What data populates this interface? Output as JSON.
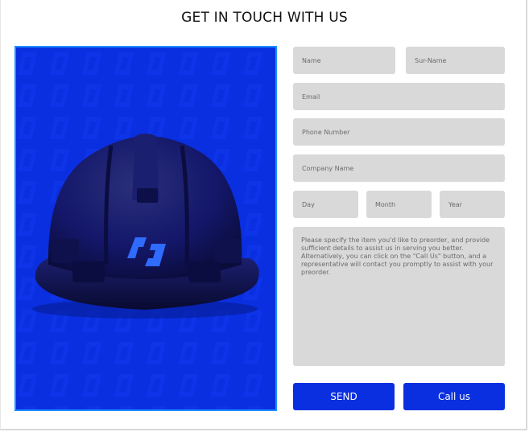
{
  "page": {
    "title": "GET IN TOUCH WITH US"
  },
  "form": {
    "name_placeholder": "Name",
    "surname_placeholder": "Sur-Name",
    "email_placeholder": "Email",
    "phone_placeholder": "Phone Number",
    "company_placeholder": "Company Name",
    "day_placeholder": "Day",
    "month_placeholder": "Month",
    "year_placeholder": "Year",
    "message_placeholder": "Please specify the item you'd like to preorder, and provide sufficient details to assist us in serving you better. Alternatively, you can click on the \"Call Us\" button, and a representative will contact you promptly to assist with your preorder.",
    "send_label": "SEND",
    "call_label": "Call us"
  },
  "image": {
    "subject": "hard-hat-icon",
    "background_color": "#0a2fe0",
    "helmet_color": "#12155a",
    "logo_color": "#2f6bff"
  },
  "colors": {
    "accent": "#0a2fe0",
    "field_bg": "#d9d9d9",
    "image_border": "#1e90ff"
  }
}
